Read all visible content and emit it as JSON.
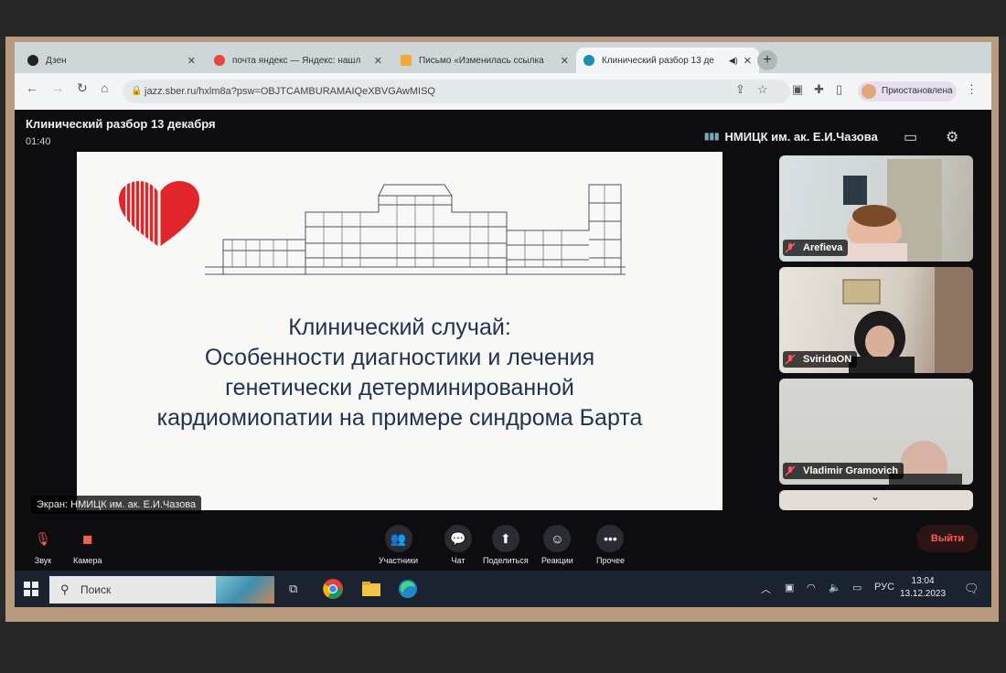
{
  "browser": {
    "tabs": [
      {
        "title": "Дзен",
        "favicon_color": "#222222"
      },
      {
        "title": "почта яндекс — Яндекс: нашл",
        "favicon_color": "#e6463c"
      },
      {
        "title": "Письмо «Изменилась ссылка",
        "favicon_color": "#f2a93b"
      },
      {
        "title": "Клинический разбор 13 де",
        "favicon_color": "#1b8fb0"
      }
    ],
    "active_tab": 3,
    "new_tab_label": "+",
    "close_label": "✕",
    "url": "jazz.sber.ru/hxlm8a?psw=OBJTCAMBURAMAIQeXBVGAwMISQ",
    "profile_label": "Приостановлена"
  },
  "meeting": {
    "title": "Клинический разбор 13 декабря",
    "elapsed": "01:40",
    "host": "НМИЦК им. ак. Е.И.Чазова",
    "screen_share_label": "Экран: НМИЦК им. ак. Е.И.Чазова"
  },
  "slide": {
    "lines": [
      "Клинический  случай:",
      "Особенности диагностики и лечения",
      "генетически детерминированной",
      "кардиомиопатии на примере синдрома Барта"
    ]
  },
  "participants": [
    {
      "name": "Arefieva",
      "muted": true
    },
    {
      "name": "SviridaON",
      "muted": true
    },
    {
      "name": "Vladimir Gramovich",
      "muted": true
    }
  ],
  "controls": {
    "sound": "Звук",
    "camera": "Камера",
    "participants": "Участники",
    "chat": "Чат",
    "share": "Поделиться",
    "reactions": "Реакции",
    "more": "Прочее",
    "leave": "Выйти"
  },
  "taskbar": {
    "search_placeholder": "Поиск",
    "language": "РУС",
    "time": "13:04",
    "date": "13.12.2023"
  },
  "colors": {
    "slide_text": "#1f3350",
    "logo_red": "#e0262b",
    "leave_red": "#ff5a5a"
  }
}
